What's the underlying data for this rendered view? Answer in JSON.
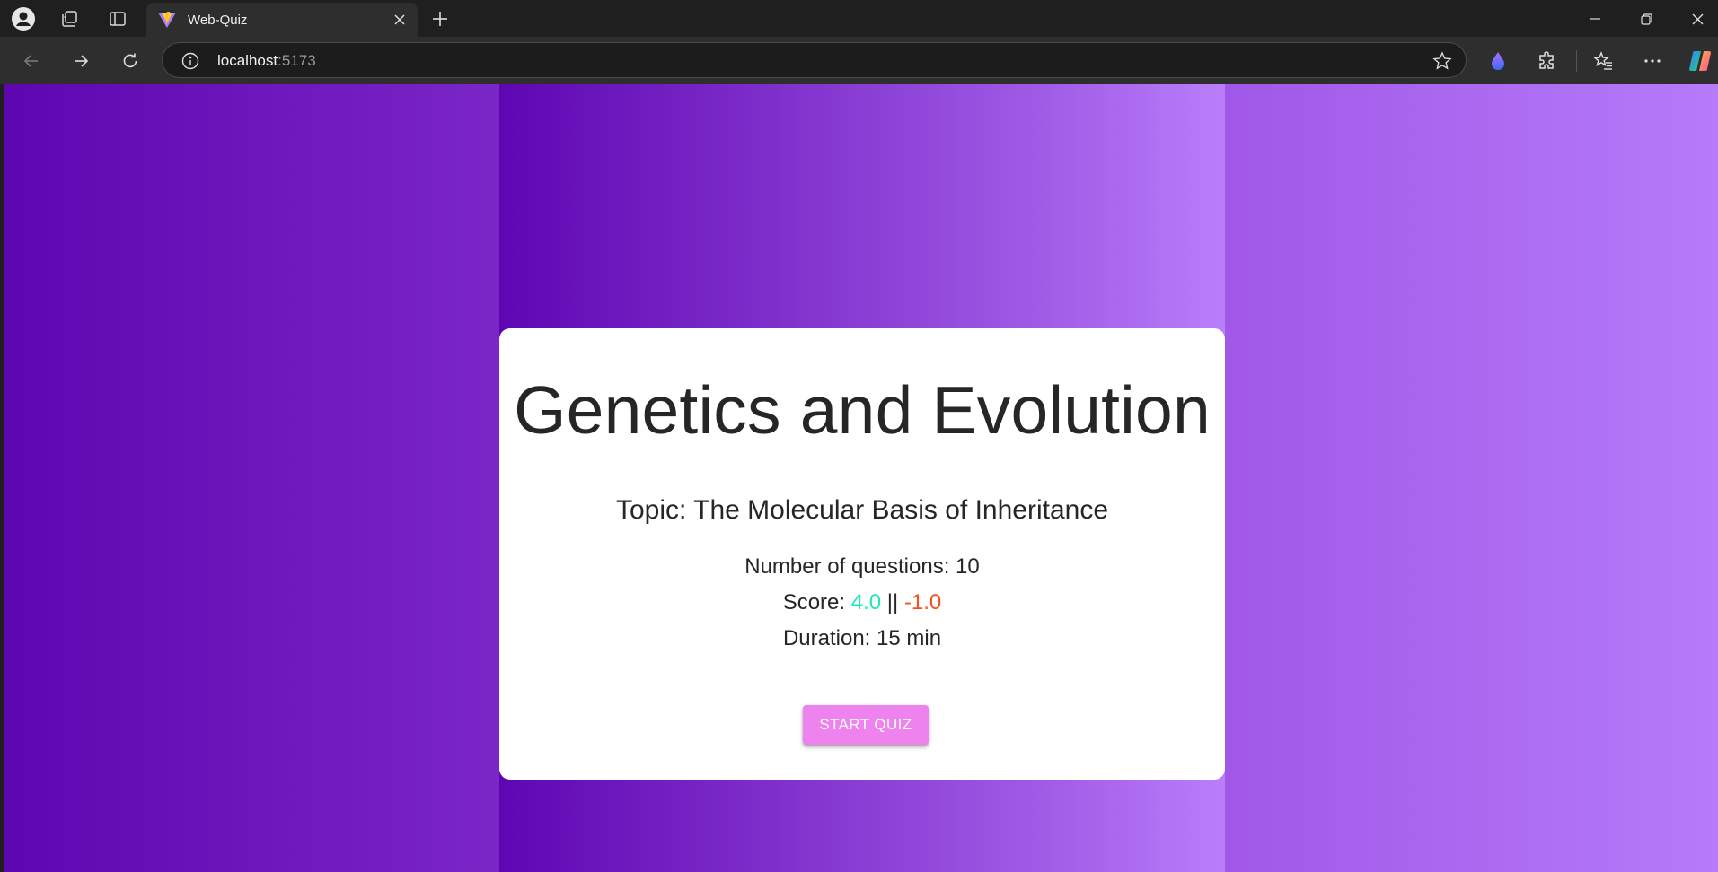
{
  "browser": {
    "tab": {
      "title": "Web-Quiz"
    },
    "address": {
      "host": "localhost",
      "port": ":5173"
    },
    "icons": [
      "profile-icon",
      "workspaces-icon",
      "tab-actions-icon",
      "vite-favicon-icon",
      "close-tab-icon",
      "new-tab-icon",
      "minimize-icon",
      "restore-icon",
      "close-window-icon",
      "back-icon",
      "forward-icon",
      "refresh-icon",
      "info-icon",
      "favorite-star-icon",
      "drop-extension-icon",
      "extensions-icon",
      "favorites-icon",
      "more-icon",
      "copilot-icon"
    ]
  },
  "quiz": {
    "title": "Genetics and Evolution",
    "topic": "Topic: The Molecular Basis of Inheritance",
    "questions_label": "Number of questions: 10",
    "score_label": "Score: ",
    "score_positive": "4.0",
    "score_separator": " || ",
    "score_negative": "-1.0",
    "duration_label": "Duration: 15 min",
    "start_button": "START QUIZ"
  },
  "colors": {
    "positive": "#1de9b6",
    "negative": "#f4511e",
    "button": "#ee82ee",
    "background_start": "#5e06b0",
    "background_end": "#b57bf9"
  }
}
